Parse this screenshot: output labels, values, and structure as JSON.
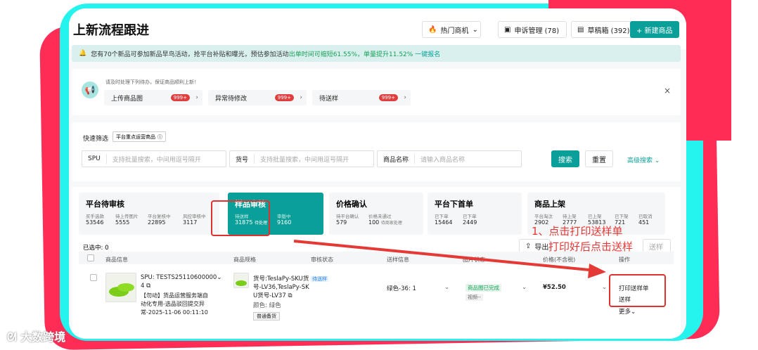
{
  "header": {
    "title": "上新流程跟进",
    "hot_label": "热门商机",
    "appeal_label": "申诉管理 (78)",
    "draft_label": "草稿箱 (392)",
    "new_label": "+ 新建商品"
  },
  "notice": {
    "prefix": "您有70个新品可参加新品早鸟活动，抢平台补贴和曝光，预估参加活动",
    "highlight": "出单时间可缩短61.55%，单量提升11.52%",
    "link": "一键报名"
  },
  "todo": {
    "hint": "请及时处理下列待办，保证商品顺利上新！",
    "items": [
      {
        "label": "上传商品图",
        "badge": "999+"
      },
      {
        "label": "异常待修改",
        "badge": "999+"
      },
      {
        "label": "待送样",
        "badge": "999+"
      }
    ]
  },
  "filter": {
    "label": "快速筛选",
    "tag": "平台重点运营商品",
    "spu_label": "SPU",
    "spu_placeholder": "支持批量搜索，中间用逗号隔开",
    "sku_label": "货号",
    "sku_placeholder": "支持批量搜索，中间用逗号隔开",
    "name_label": "商品名称",
    "name_placeholder": "请输入商品名称",
    "search": "搜索",
    "reset": "重置",
    "advanced": "高级搜索"
  },
  "stats": [
    {
      "title": "平台待审核",
      "items": [
        {
          "sub": "买手选款",
          "num": "53546"
        },
        {
          "sub": "待上传图片",
          "num": "5555"
        },
        {
          "sub": "平台复核中",
          "num": "22895"
        },
        {
          "sub": "风控审核中",
          "num": "3117"
        }
      ]
    },
    {
      "title": "样品审核",
      "items": [
        {
          "sub": "待送样",
          "num": "31875",
          "extra": "待处理"
        },
        {
          "sub": "审版中",
          "num": "9160"
        }
      ]
    },
    {
      "title": "价格确认",
      "items": [
        {
          "sub": "待平台确认",
          "num": "579"
        },
        {
          "sub": "价格未通过",
          "num": "100",
          "extra": "待商家处理"
        }
      ]
    },
    {
      "title": "平台下首单",
      "items": [
        {
          "sub": "已下单",
          "num": "15464"
        },
        {
          "sub": "已下单",
          "num": "2449"
        }
      ]
    },
    {
      "title": "商品上架",
      "items": [
        {
          "sub": "平台淘汰",
          "num": "2902"
        },
        {
          "sub": "待上架",
          "num": "2777"
        },
        {
          "sub": "已上架",
          "num": "53813"
        },
        {
          "sub": "已下架",
          "num": "721"
        },
        {
          "sub": "已取消",
          "num": "451"
        }
      ]
    }
  ],
  "table": {
    "selected": "已选中: 0",
    "export": "导出",
    "batch": "送样",
    "headers": [
      "商品信息",
      "商品规格",
      "审核状态",
      "送样信息",
      "图片状态",
      "价格(不含税)",
      "操作"
    ],
    "row": {
      "spu": "SPU: TESTS25110600000",
      "spu_num": "4",
      "desc1": "【勿动】货品运营服务端自",
      "desc2": "动化专用-选品驳回提交异",
      "desc3": "常-2025-11-06 00:11:10",
      "sku1": "货号:TeslaPy-SKU货",
      "sku2": "号-LV36,TeslaPy-SK",
      "sku3": "U货号-LV37",
      "color": "颜色: 绿色",
      "tag": "普通备货",
      "status": "待送样",
      "sample": "绿色-36: 1",
      "img_status": "商品图已完成",
      "video": "视频--",
      "price": "¥52.50",
      "op1": "打印送样单",
      "op2": "送样",
      "op3": "更多"
    }
  },
  "annotation": {
    "line1": "1、点击打印送样单",
    "line2": "打印好后点击送样"
  },
  "watermark": "大数跨境",
  "colors": {
    "accent": "#0a9f98",
    "annotation": "#e53935",
    "frame_pink": "#ff2d55",
    "frame_cyan": "#25f4ee"
  }
}
